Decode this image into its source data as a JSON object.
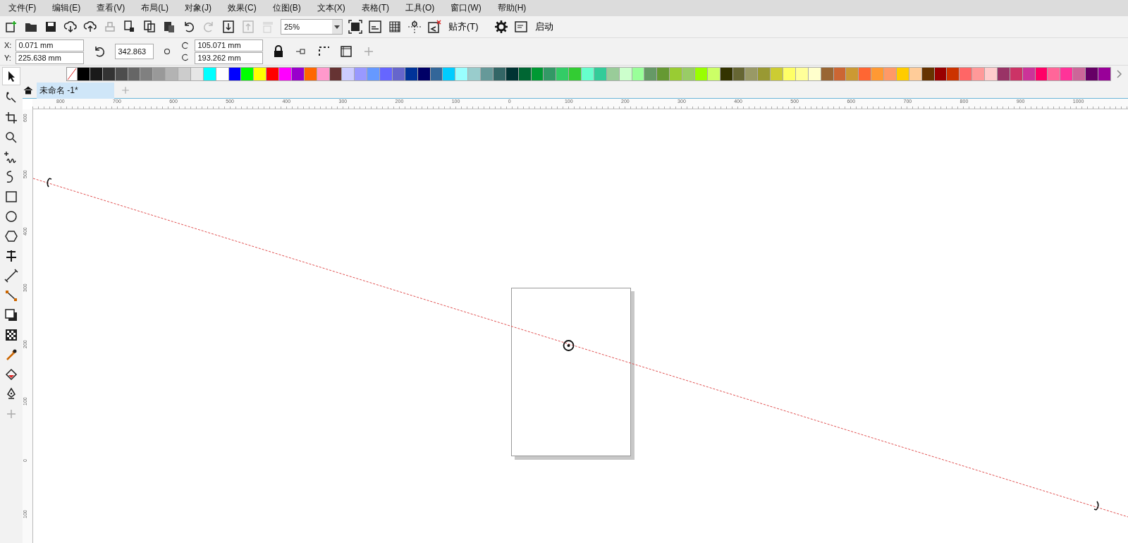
{
  "menu": [
    "文件(F)",
    "编辑(E)",
    "查看(V)",
    "布局(L)",
    "对象(J)",
    "效果(C)",
    "位图(B)",
    "文本(X)",
    "表格(T)",
    "工具(O)",
    "窗口(W)",
    "帮助(H)"
  ],
  "toolbar": {
    "zoom": "25%",
    "snap": "贴齐(T)",
    "launch": "启动"
  },
  "properties": {
    "x_label": "X:",
    "x": "0.071 mm",
    "y_label": "Y:",
    "y": "225.638 mm",
    "angle": "342.863",
    "cx": "105.071 mm",
    "cy": "193.262 mm"
  },
  "palette": [
    {
      "color": "#000000"
    },
    {
      "color": "#1a1a1a"
    },
    {
      "color": "#333333"
    },
    {
      "color": "#4d4d4d"
    },
    {
      "color": "#666666"
    },
    {
      "color": "#808080"
    },
    {
      "color": "#999999"
    },
    {
      "color": "#b3b3b3"
    },
    {
      "color": "#cccccc"
    },
    {
      "color": "#e6e6e6"
    },
    {
      "color": "#00ffff"
    },
    {
      "color": "#ffffff"
    },
    {
      "color": "#0000ff"
    },
    {
      "color": "#00ff00"
    },
    {
      "color": "#ffff00"
    },
    {
      "color": "#ff0000"
    },
    {
      "color": "#ff00ff"
    },
    {
      "color": "#9900cc"
    },
    {
      "color": "#ff6600"
    },
    {
      "color": "#ff99cc"
    },
    {
      "color": "#663333"
    },
    {
      "color": "#ccccff"
    },
    {
      "color": "#9999ff"
    },
    {
      "color": "#6699ff"
    },
    {
      "color": "#6666ff"
    },
    {
      "color": "#6666cc"
    },
    {
      "color": "#003399"
    },
    {
      "color": "#000066"
    },
    {
      "color": "#336699"
    },
    {
      "color": "#00ccff"
    },
    {
      "color": "#99ffff"
    },
    {
      "color": "#99cccc"
    },
    {
      "color": "#669999"
    },
    {
      "color": "#336666"
    },
    {
      "color": "#003333"
    },
    {
      "color": "#006633"
    },
    {
      "color": "#009933"
    },
    {
      "color": "#339966"
    },
    {
      "color": "#33cc66"
    },
    {
      "color": "#33cc33"
    },
    {
      "color": "#66ffcc"
    },
    {
      "color": "#33cc99"
    },
    {
      "color": "#99cc99"
    },
    {
      "color": "#ccffcc"
    },
    {
      "color": "#99ff99"
    },
    {
      "color": "#669966"
    },
    {
      "color": "#669933"
    },
    {
      "color": "#99cc33"
    },
    {
      "color": "#99cc66"
    },
    {
      "color": "#99ff00"
    },
    {
      "color": "#ccff66"
    },
    {
      "color": "#333300"
    },
    {
      "color": "#666633"
    },
    {
      "color": "#999966"
    },
    {
      "color": "#999933"
    },
    {
      "color": "#cccc33"
    },
    {
      "color": "#ffff66"
    },
    {
      "color": "#ffff99"
    },
    {
      "color": "#ffffcc"
    },
    {
      "color": "#996633"
    },
    {
      "color": "#cc6633"
    },
    {
      "color": "#cc9933"
    },
    {
      "color": "#ff6633"
    },
    {
      "color": "#ff9933"
    },
    {
      "color": "#ff9966"
    },
    {
      "color": "#ffcc00"
    },
    {
      "color": "#ffcc99"
    },
    {
      "color": "#663300"
    },
    {
      "color": "#990000"
    },
    {
      "color": "#cc3300"
    },
    {
      "color": "#ff6666"
    },
    {
      "color": "#ff9999"
    },
    {
      "color": "#ffcccc"
    },
    {
      "color": "#993366"
    },
    {
      "color": "#cc3366"
    },
    {
      "color": "#cc3399"
    },
    {
      "color": "#ff0066"
    },
    {
      "color": "#ff6699"
    },
    {
      "color": "#ff3399"
    },
    {
      "color": "#cc6699"
    },
    {
      "color": "#660066"
    },
    {
      "color": "#990099"
    }
  ],
  "tabs": [
    {
      "label": "未命名 -1*",
      "selected": true
    }
  ],
  "ruler_h": [
    "800",
    "700",
    "600",
    "500",
    "400",
    "300",
    "200",
    "100",
    "0",
    "100",
    "200",
    "300",
    "400",
    "500",
    "600",
    "700",
    "800",
    "900",
    "1000"
  ],
  "ruler_v": [
    "600",
    "500",
    "400",
    "300",
    "200",
    "100",
    "0",
    "100"
  ]
}
